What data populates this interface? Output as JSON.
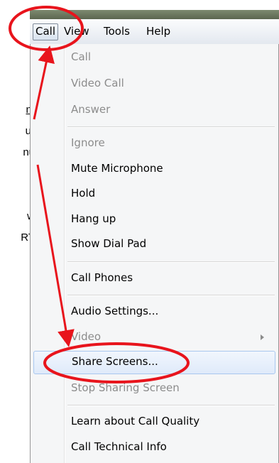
{
  "side_text": {
    "line1": "n:",
    "line2": "u)",
    "line3": "nu",
    "line4": "w",
    "line5": "RT"
  },
  "menubar": {
    "items": [
      {
        "label": "Call"
      },
      {
        "label": "View"
      },
      {
        "label": "Tools"
      },
      {
        "label": "Help"
      }
    ]
  },
  "menu": {
    "items": [
      {
        "label": "Call"
      },
      {
        "label": "Video Call"
      },
      {
        "label": "Answer"
      },
      {
        "label": "Ignore"
      },
      {
        "label": "Mute Microphone"
      },
      {
        "label": "Hold"
      },
      {
        "label": "Hang up"
      },
      {
        "label": "Show Dial Pad"
      },
      {
        "label": "Call Phones"
      },
      {
        "label": "Audio Settings..."
      },
      {
        "label": "Video"
      },
      {
        "label": "Share Screens..."
      },
      {
        "label": "Stop Sharing Screen"
      },
      {
        "label": "Learn about Call Quality"
      },
      {
        "label": "Call Technical Info"
      }
    ]
  },
  "colors": {
    "annotation": "#e8141c",
    "highlight_border": "#a8c7ef",
    "disabled_text": "#8c8c8c"
  }
}
